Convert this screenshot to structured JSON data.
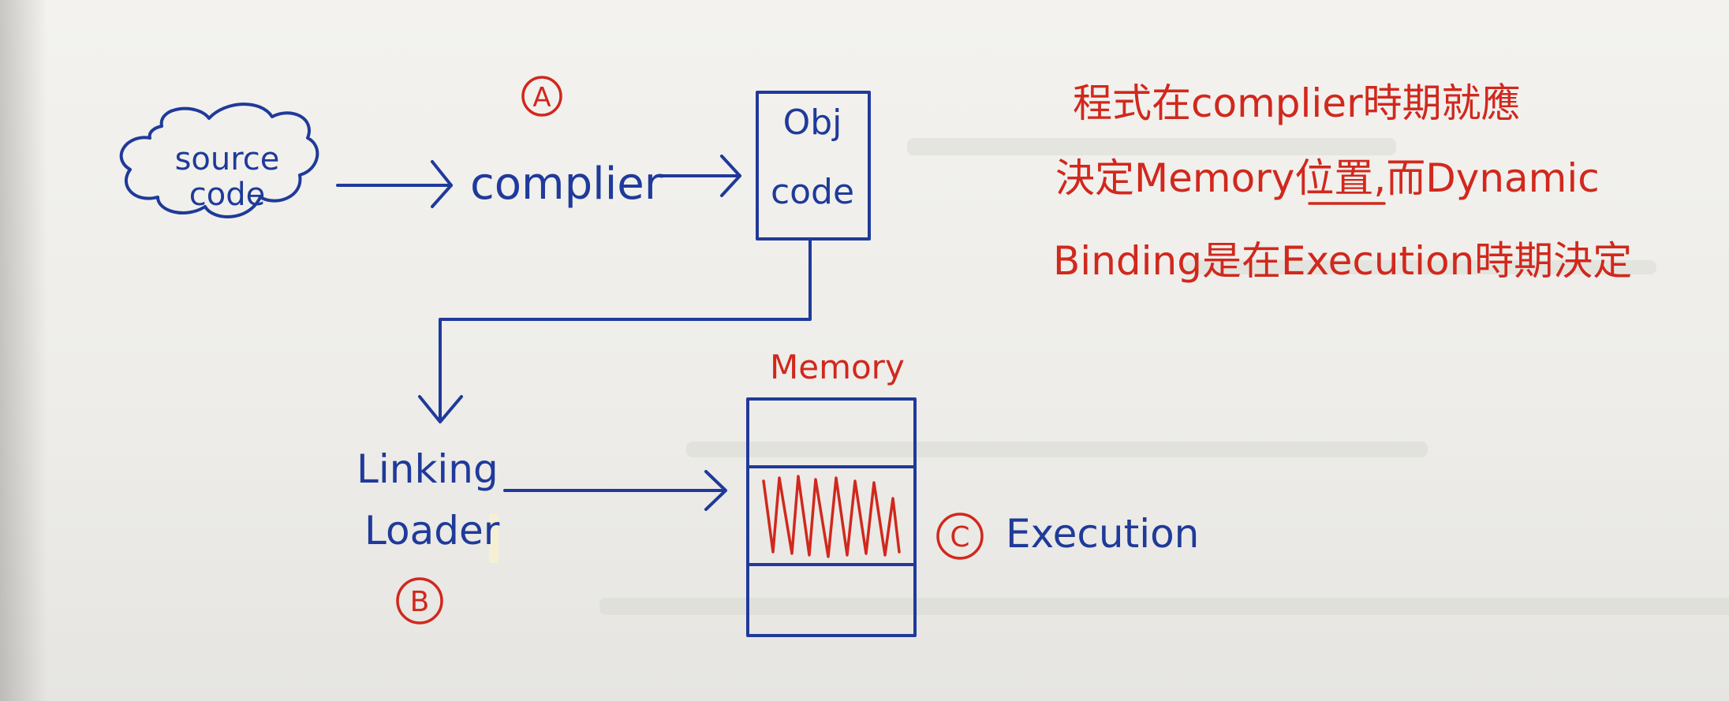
{
  "diagram": {
    "source_label": "source code",
    "source_line1": "source",
    "source_line2": "code",
    "compiler_label": "complier",
    "marker_a": "A",
    "obj_line1": "Obj",
    "obj_line2": "code",
    "linking_line1": "Linking",
    "linking_line2": "Loader",
    "marker_b": "B",
    "memory_label": "Memory",
    "marker_c": "C",
    "execution_label": "Execution"
  },
  "note": {
    "line1": "程式在complier時期就應",
    "line2": "決定Memory位置,而Dynamic",
    "line3": "Binding是在Execution時期決定"
  },
  "colors": {
    "blue_ink": "#1f3a9a",
    "red_ink": "#d1281d",
    "paper": "#eeede9"
  }
}
